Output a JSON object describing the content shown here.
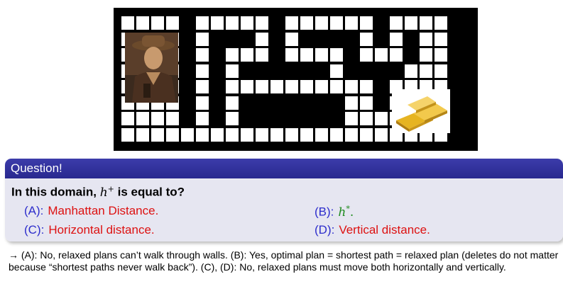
{
  "question": {
    "title": "Question!",
    "prompt_prefix": "In this domain,",
    "h_symbol": "h",
    "h_superscript": "+",
    "prompt_suffix": "is equal to?",
    "options": [
      {
        "label": "(A):",
        "text": "Manhattan Distance."
      },
      {
        "label": "(B):",
        "text": "h",
        "sup": "*",
        "after": "."
      },
      {
        "label": "(C):",
        "text": "Horizontal distance."
      },
      {
        "label": "(D):",
        "text": "Vertical distance."
      }
    ]
  },
  "answer": {
    "text": "→ (A): No, relaxed plans can’t walk through walls. (B): Yes, optimal plan = shortest path = relaxed plan (deletes do not matter because “shortest paths never walk back”). (C), (D): No, relaxed plans must move both horizontally and vertically."
  },
  "colors": {
    "header": "#28288f",
    "body": "#e6e6f1",
    "option_label": "#2d2dcc",
    "option_text": "#dd1111",
    "math_text": "#1d8a1d"
  },
  "icons": {
    "player": "explorer-character-icon",
    "goal": "gold-bars-icon"
  }
}
